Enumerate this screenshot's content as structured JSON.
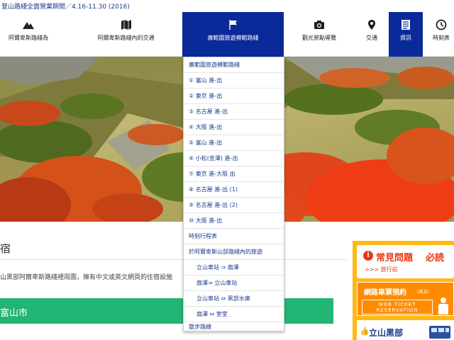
{
  "notice": {
    "text": "登山路綫全面營業期間／4.16-11.30 (2016)"
  },
  "nav": {
    "items": [
      {
        "label": "阿爾卑斯路綫為",
        "icon": "mountain-icon"
      },
      {
        "label": "阿爾卑斯路綫內的交通",
        "icon": "map-icon"
      },
      {
        "label": "廣範圍旅遊模範路綫",
        "icon": "flag-icon",
        "active": true
      },
      {
        "label": "觀光景點導覽",
        "icon": "camera-icon"
      },
      {
        "label": "交通",
        "icon": "pin-icon"
      },
      {
        "label": "資訊",
        "icon": "document-icon"
      },
      {
        "label": "時刻表",
        "icon": "clock-icon"
      }
    ]
  },
  "dropdown": {
    "items": [
      "廣範圍旅遊模範路綫",
      "① 富山 進-出",
      "② 東京 進-出",
      "③ 名古屋 進-出",
      "④ 大阪 進-出",
      "⑤ 富山 進-出",
      "⑥ 小松(金澤) 進-出",
      "⑦ 東京 進-大阪 出",
      "⑧ 名古屋 進-出 (1)",
      "⑨ 名古屋 進-出 (2)",
      "⑩ 大阪 進-出",
      "時刻行程表",
      "於阿爾卑斯山部路綫內的旅遊",
      "立山車站 ⇒ 扇澤",
      "扇澤⇒ 立山車站",
      "立山車站 ⇔ 黑部水庫",
      "扇澤 ⇔ 室堂",
      "散步路線"
    ]
  },
  "content": {
    "heading": "宿",
    "description": "山黑部阿爾卑斯路綫裡周圍，擁有中文或英文網頁的住宿設施",
    "section_title": "富山市"
  },
  "sidebar": {
    "faq": {
      "icon_text": "i",
      "title1": "常見問題",
      "title2": "必読",
      "link": ">>> 旅行前"
    },
    "ticket": {
      "title": "網路車票預約",
      "title_suffix": "(英文)",
      "line1": "WEB TICKET",
      "line2": "RESERVATION"
    },
    "banner": {
      "text": "立山黑部"
    }
  },
  "colors": {
    "nav_active": "#0b2a99",
    "accent_green": "#22b573",
    "sidebar_orange": "#ffb914",
    "ticket_orange": "#ff8c00"
  }
}
